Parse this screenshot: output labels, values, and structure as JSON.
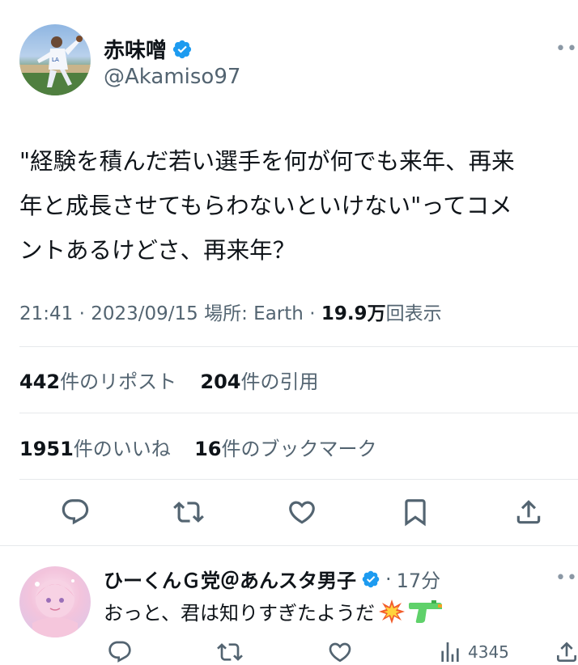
{
  "tweet": {
    "author_name": "赤味噌",
    "author_handle": "@Akamiso97",
    "text_lines": [
      "\"経験を積んだ若い選手を何が何でも来年、再来",
      "年と成長させてもらわないといけない\"ってコメ",
      "ントあるけどさ、再来年？"
    ],
    "time": "21:41",
    "date": "2023/09/15",
    "location_label": "場所: Earth",
    "views_value": "19.9",
    "views_unit": "万",
    "views_label": "回表示",
    "reposts_count": "442",
    "reposts_label": "件のリポスト",
    "quotes_count": "204",
    "quotes_label": "件の引用",
    "likes_count": "1951",
    "likes_label": "件のいいね",
    "bookmarks_count": "16",
    "bookmarks_label": "件のブックマーク"
  },
  "reply": {
    "name": "ひーくんＧ党＠あんスタ男子",
    "time": "17分",
    "text": "おっと、君は知りすぎたようだ",
    "views": "4345"
  },
  "icons": {
    "verified": "verified-badge-icon",
    "more": "more-icon",
    "reply": "reply-icon",
    "repost": "repost-icon",
    "like": "like-icon",
    "bookmark": "bookmark-icon",
    "share": "share-icon",
    "views": "views-icon",
    "emoji1": "collision-emoji",
    "emoji2": "water-pistol-emoji"
  },
  "colors": {
    "verified_blue": "#1d9bf0",
    "text": "#0f1419",
    "secondary": "#536471",
    "divider": "#e6e9eb"
  }
}
